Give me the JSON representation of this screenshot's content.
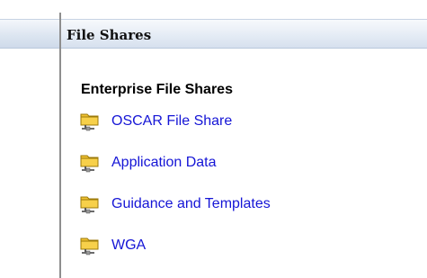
{
  "webpart": {
    "title": "File Shares"
  },
  "section": {
    "heading": "Enterprise File Shares"
  },
  "shares": [
    {
      "label": "OSCAR File Share",
      "icon": "network-folder-icon"
    },
    {
      "label": "Application Data",
      "icon": "network-folder-icon"
    },
    {
      "label": "Guidance and Templates",
      "icon": "network-folder-icon"
    },
    {
      "label": "WGA",
      "icon": "network-folder-icon"
    }
  ],
  "colors": {
    "link": "#1515d6",
    "folder": "#e8b410",
    "title_bar": "#dde6f1"
  }
}
